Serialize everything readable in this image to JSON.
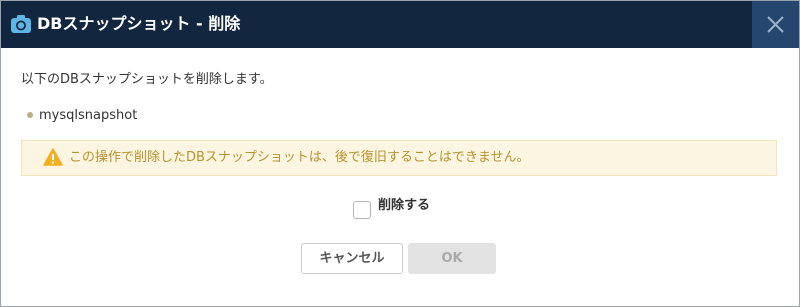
{
  "dialog": {
    "title": "DBスナップショット - 削除",
    "title_icon": "camera-icon",
    "close_icon": "close-icon"
  },
  "body": {
    "message": "以下のDBスナップショットを削除します。",
    "items": [
      "mysqlsnapshot"
    ],
    "warning_icon": "warning-icon",
    "warning": "この操作で削除したDBスナップショットは、後で復旧することはできません。",
    "confirm_label": "削除する",
    "confirm_checked": false
  },
  "buttons": {
    "cancel": "キャンセル",
    "ok": "OK"
  },
  "colors": {
    "header_bg": "#12263f",
    "close_bg": "#24466f",
    "warning_bg": "#fcf5e1",
    "warning_text": "#b8922c",
    "warning_icon": "#f2b01e"
  }
}
